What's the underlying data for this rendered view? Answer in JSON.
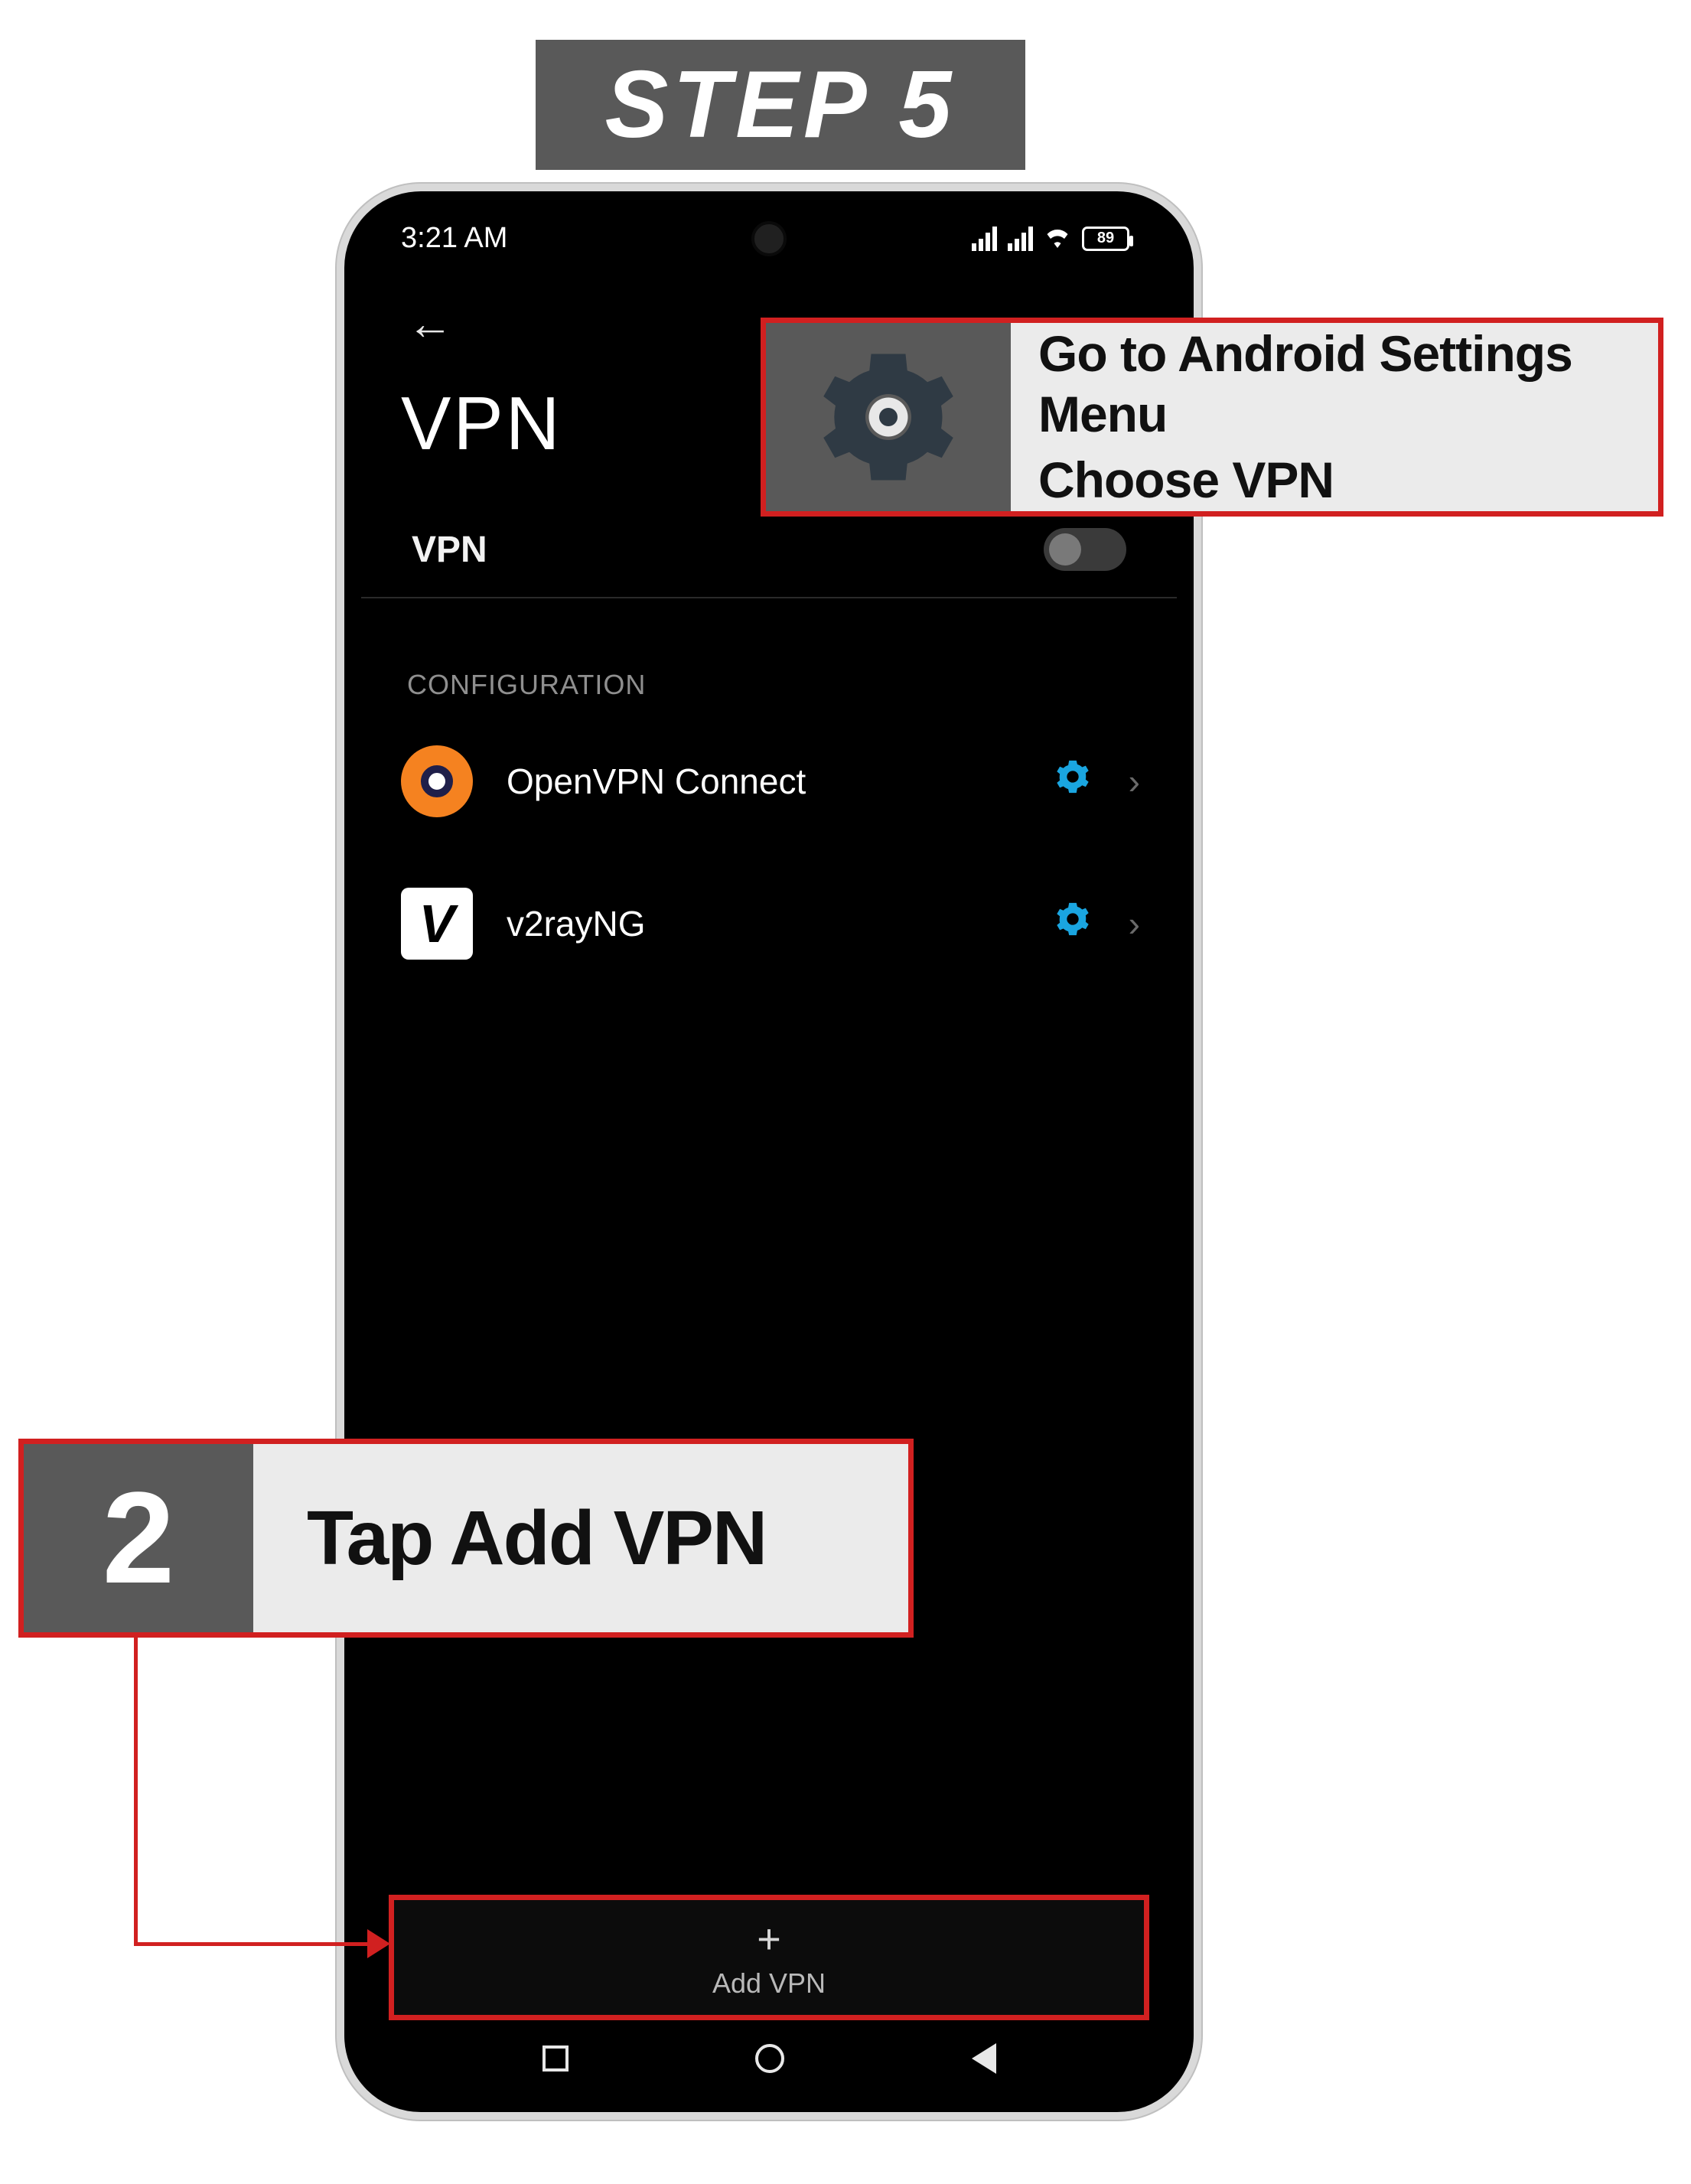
{
  "step_badge": "STEP 5",
  "status": {
    "time": "3:21 AM",
    "battery": "89"
  },
  "page_title": "VPN",
  "vpn_toggle": {
    "label": "VPN",
    "on": false
  },
  "section_label": "CONFIGURATION",
  "configs": [
    {
      "name": "OpenVPN Connect",
      "icon": "openvpn"
    },
    {
      "name": "v2rayNG",
      "icon": "v2rayng"
    }
  ],
  "add_vpn": {
    "label": "Add VPN"
  },
  "callout1": {
    "line1": "Go to Android Settings Menu",
    "line2": "Choose VPN"
  },
  "callout2": {
    "number": "2",
    "text": "Tap Add VPN"
  }
}
